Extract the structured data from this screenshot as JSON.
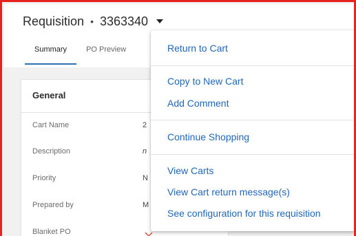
{
  "header": {
    "title": "Requisition",
    "separator": "•",
    "number": "3363340"
  },
  "tabs": [
    {
      "label": "Summary",
      "active": true
    },
    {
      "label": "PO Preview",
      "active": false
    }
  ],
  "general": {
    "title": "General",
    "fields": [
      {
        "label": "Cart Name",
        "value": "2"
      },
      {
        "label": "Description",
        "value": "n"
      },
      {
        "label": "Priority",
        "value": "N"
      },
      {
        "label": "Prepared by",
        "value": "M"
      },
      {
        "label": "Blanket PO",
        "value_icon": "x-icon"
      }
    ]
  },
  "menu": {
    "groups": [
      [
        "Return to Cart"
      ],
      [
        "Copy to New Cart",
        "Add Comment"
      ],
      [
        "Continue Shopping"
      ],
      [
        "View Carts",
        "View Cart return message(s)",
        "See configuration for this requisition"
      ]
    ]
  },
  "colors": {
    "frame_border": "#e8231f",
    "link": "#2166b8",
    "tab_underline": "#2b6fb6",
    "x_icon": "#e05a4f"
  }
}
